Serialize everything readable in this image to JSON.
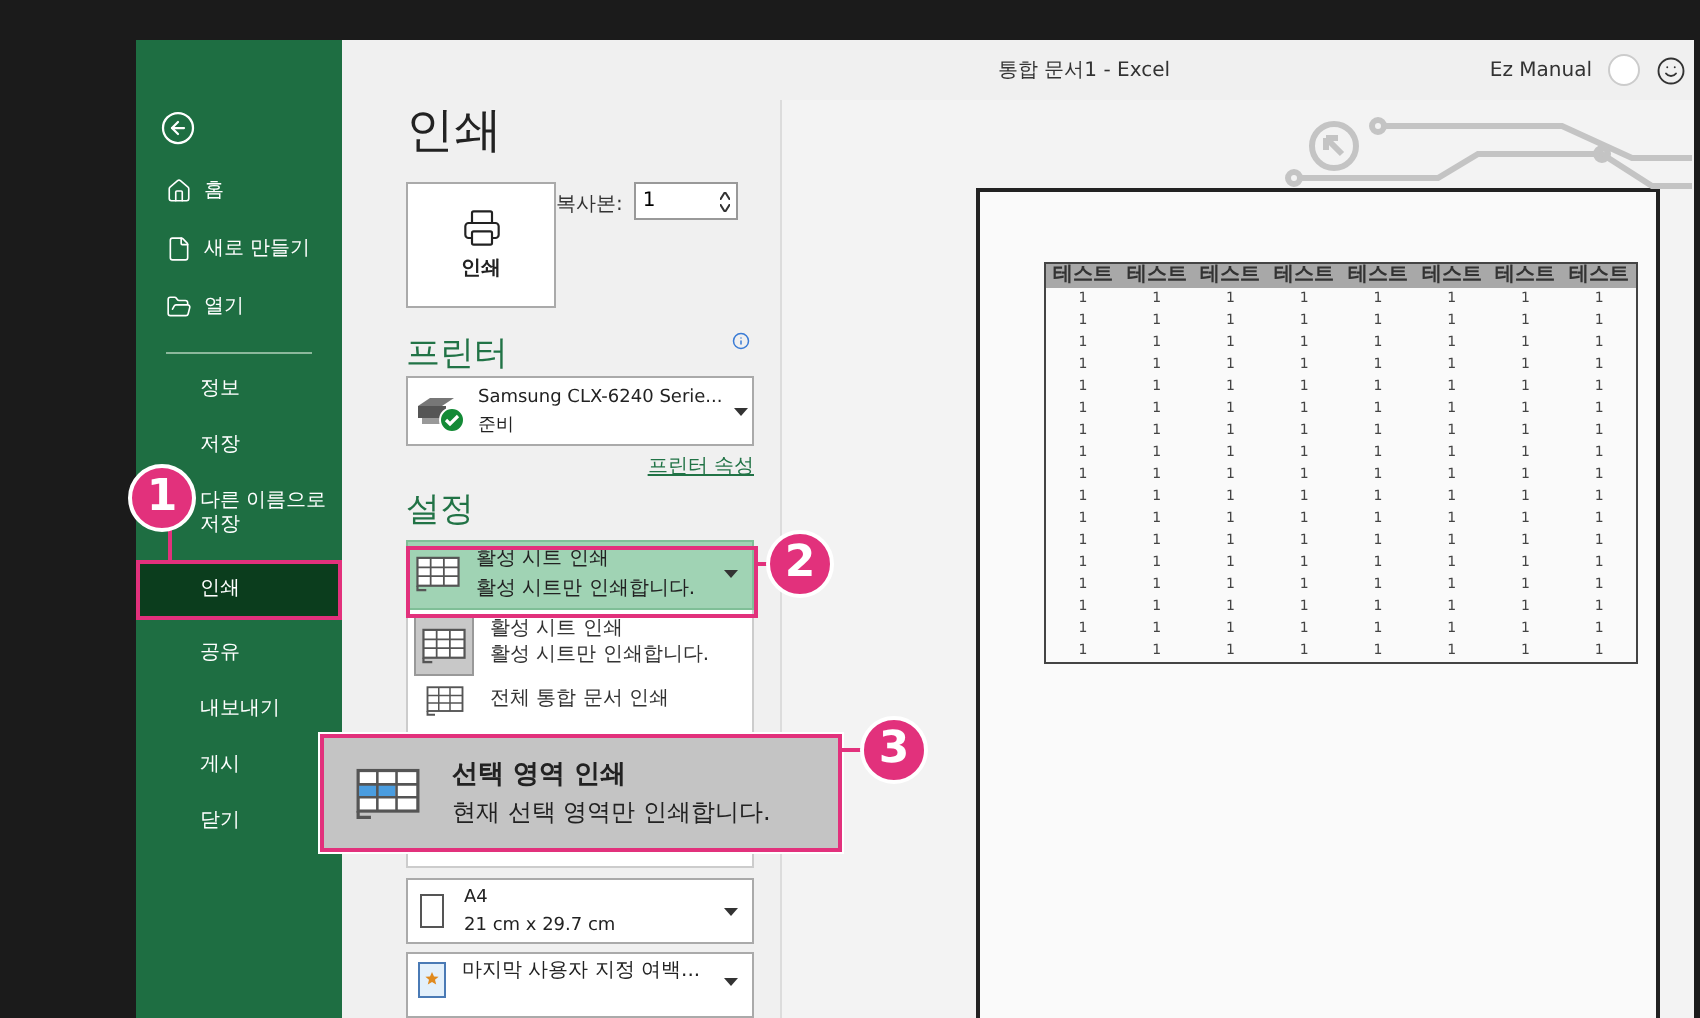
{
  "window": {
    "title": "통합 문서1 - Excel",
    "user": "Ez Manual"
  },
  "sidebar": {
    "top_items": [
      {
        "label": "홈"
      },
      {
        "label": "새로 만들기"
      },
      {
        "label": "열기"
      }
    ],
    "items": [
      {
        "label": "정보",
        "selected": false
      },
      {
        "label": "저장",
        "selected": false
      },
      {
        "label": "다른 이름으로 저장",
        "selected": false
      },
      {
        "label": "인쇄",
        "selected": true
      },
      {
        "label": "공유",
        "selected": false
      },
      {
        "label": "내보내기",
        "selected": false
      },
      {
        "label": "게시",
        "selected": false
      },
      {
        "label": "닫기",
        "selected": false
      }
    ]
  },
  "print": {
    "heading": "인쇄",
    "button": "인쇄",
    "copies_label": "복사본:",
    "copies": "1"
  },
  "printer": {
    "heading": "프린터",
    "name": "Samsung CLX-6240 Serie...",
    "status": "준비",
    "properties_link": "프린터 속성"
  },
  "settings": {
    "heading": "설정",
    "selector": {
      "title": "활성 시트 인쇄",
      "subtitle": "활성 시트만 인쇄합니다.",
      "hovered": true
    },
    "menu": [
      {
        "title": "활성 시트 인쇄",
        "subtitle": "활성 시트만 인쇄합니다.",
        "selected": true
      },
      {
        "title": "전체 통합 문서 인쇄",
        "selected": false
      }
    ],
    "paper": {
      "title": "A4",
      "subtitle": "21 cm x 29.7 cm"
    },
    "margins": {
      "title": "마지막 사용자 지정 여백..."
    }
  },
  "preview": {
    "columns": [
      "테스트",
      "테스트",
      "테스트",
      "테스트",
      "테스트",
      "테스트",
      "테스트",
      "테스트"
    ],
    "rows": [
      [
        "1",
        "1",
        "1",
        "1",
        "1",
        "1",
        "1",
        "1"
      ],
      [
        "1",
        "1",
        "1",
        "1",
        "1",
        "1",
        "1",
        "1"
      ],
      [
        "1",
        "1",
        "1",
        "1",
        "1",
        "1",
        "1",
        "1"
      ],
      [
        "1",
        "1",
        "1",
        "1",
        "1",
        "1",
        "1",
        "1"
      ],
      [
        "1",
        "1",
        "1",
        "1",
        "1",
        "1",
        "1",
        "1"
      ],
      [
        "1",
        "1",
        "1",
        "1",
        "1",
        "1",
        "1",
        "1"
      ],
      [
        "1",
        "1",
        "1",
        "1",
        "1",
        "1",
        "1",
        "1"
      ],
      [
        "1",
        "1",
        "1",
        "1",
        "1",
        "1",
        "1",
        "1"
      ],
      [
        "1",
        "1",
        "1",
        "1",
        "1",
        "1",
        "1",
        "1"
      ],
      [
        "1",
        "1",
        "1",
        "1",
        "1",
        "1",
        "1",
        "1"
      ],
      [
        "1",
        "1",
        "1",
        "1",
        "1",
        "1",
        "1",
        "1"
      ],
      [
        "1",
        "1",
        "1",
        "1",
        "1",
        "1",
        "1",
        "1"
      ],
      [
        "1",
        "1",
        "1",
        "1",
        "1",
        "1",
        "1",
        "1"
      ],
      [
        "1",
        "1",
        "1",
        "1",
        "1",
        "1",
        "1",
        "1"
      ],
      [
        "1",
        "1",
        "1",
        "1",
        "1",
        "1",
        "1",
        "1"
      ],
      [
        "1",
        "1",
        "1",
        "1",
        "1",
        "1",
        "1",
        "1"
      ],
      [
        "1",
        "1",
        "1",
        "1",
        "1",
        "1",
        "1",
        "1"
      ]
    ]
  },
  "callouts": [
    {
      "number": "1"
    },
    {
      "number": "2"
    },
    {
      "number": "3",
      "title": "선택 영역 인쇄",
      "subtitle": "현재 선택 영역만 인쇄합니다."
    }
  ]
}
